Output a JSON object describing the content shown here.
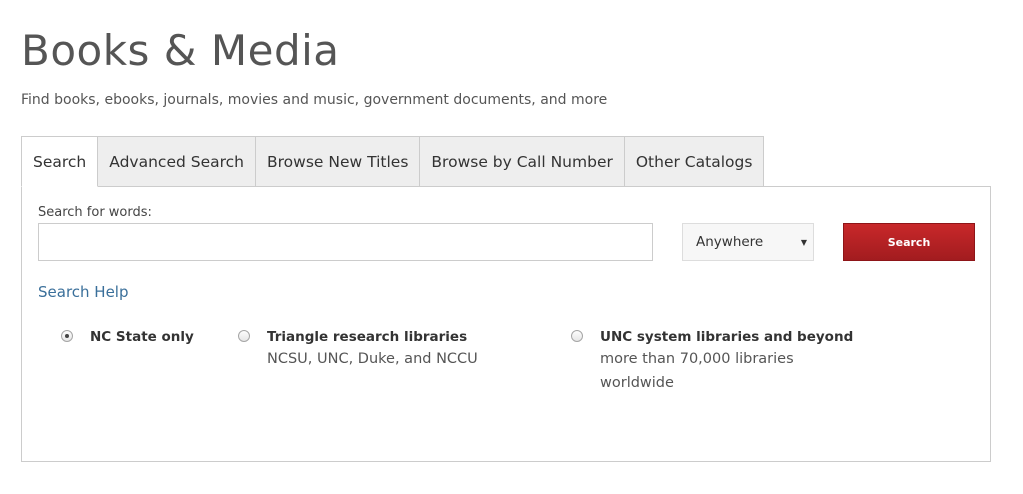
{
  "header": {
    "title": "Books & Media",
    "subtitle": "Find books, ebooks, journals, movies and music, government documents, and more"
  },
  "tabs": [
    {
      "label": "Search",
      "active": true
    },
    {
      "label": "Advanced Search",
      "active": false
    },
    {
      "label": "Browse New Titles",
      "active": false
    },
    {
      "label": "Browse by Call Number",
      "active": false
    },
    {
      "label": "Other Catalogs",
      "active": false
    }
  ],
  "search": {
    "label": "Search for words:",
    "value": "",
    "scope_selected": "Anywhere",
    "button_label": "Search",
    "help_link": "Search Help"
  },
  "options": [
    {
      "title": "NC State only",
      "desc_lines": [],
      "checked": true
    },
    {
      "title": "Triangle research libraries",
      "desc_lines": [
        "NCSU, UNC, Duke, and NCCU"
      ],
      "checked": false
    },
    {
      "title": "UNC system libraries and beyond",
      "desc_lines": [
        "more than 70,000 libraries",
        "worldwide"
      ],
      "checked": false
    }
  ],
  "colors": {
    "button": "#b22222",
    "link": "#3a6f9a",
    "tab_bg": "#eeeeee",
    "border": "#cccccc"
  }
}
